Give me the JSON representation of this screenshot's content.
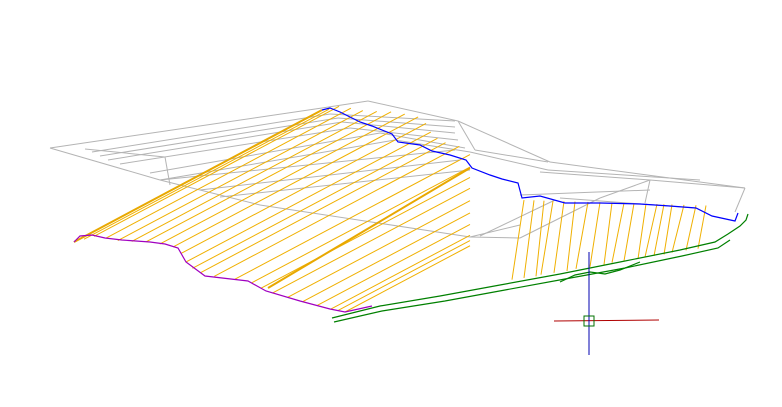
{
  "viewport": {
    "background": "#ffffff",
    "cursor": {
      "icon": "crosshair-cursor-icon",
      "pickbox_icon": "pickbox-square-icon",
      "x_axis_color": "#b00000",
      "y_axis_color": "#0000b0",
      "pickbox_color": "#007000"
    }
  },
  "model": {
    "colors": {
      "surface_mesh": "#b4b4b4",
      "top_boundary": "#0000ff",
      "bottom_boundary": "#a000c0",
      "hatch_lines": "#f0b000",
      "ridge_lines": "#e8a800",
      "toe_polyline": "#008000"
    }
  }
}
